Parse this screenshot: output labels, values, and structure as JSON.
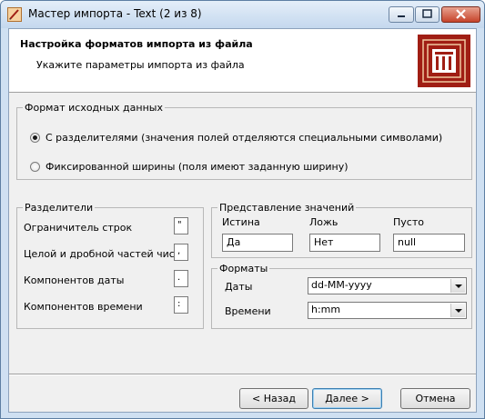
{
  "window": {
    "title": "Мастер импорта - Text (2 из 8)"
  },
  "header": {
    "title": "Настройка форматов импорта из файла",
    "subtitle": "Укажите параметры импорта из файла"
  },
  "source_format": {
    "legend": "Формат исходных данных",
    "options": [
      {
        "label": "С разделителями (значения полей отделяются специальными символами)",
        "selected": true
      },
      {
        "label": "Фиксированной ширины (поля имеют заданную ширину)",
        "selected": false
      }
    ]
  },
  "separators": {
    "legend": "Разделители",
    "rows": [
      {
        "label": "Ограничитель строк",
        "value": "\""
      },
      {
        "label": "Целой и дробной частей числа",
        "value": ","
      },
      {
        "label": "Компонентов даты",
        "value": "."
      },
      {
        "label": "Компонентов времени",
        "value": ":"
      }
    ]
  },
  "values": {
    "legend": "Представление значений",
    "true_label": "Истина",
    "true_value": "Да",
    "false_label": "Ложь",
    "false_value": "Нет",
    "empty_label": "Пусто",
    "empty_value": "null"
  },
  "formats": {
    "legend": "Форматы",
    "date_label": "Даты",
    "date_value": "dd-MM-yyyy",
    "time_label": "Времени",
    "time_value": "h:mm"
  },
  "buttons": {
    "back": "< Назад",
    "next": "Далее >",
    "cancel": "Отмена"
  },
  "colors": {
    "logo_red": "#a01e14",
    "titlebar": "#cfe0f2",
    "close_button": "#c6432a"
  }
}
